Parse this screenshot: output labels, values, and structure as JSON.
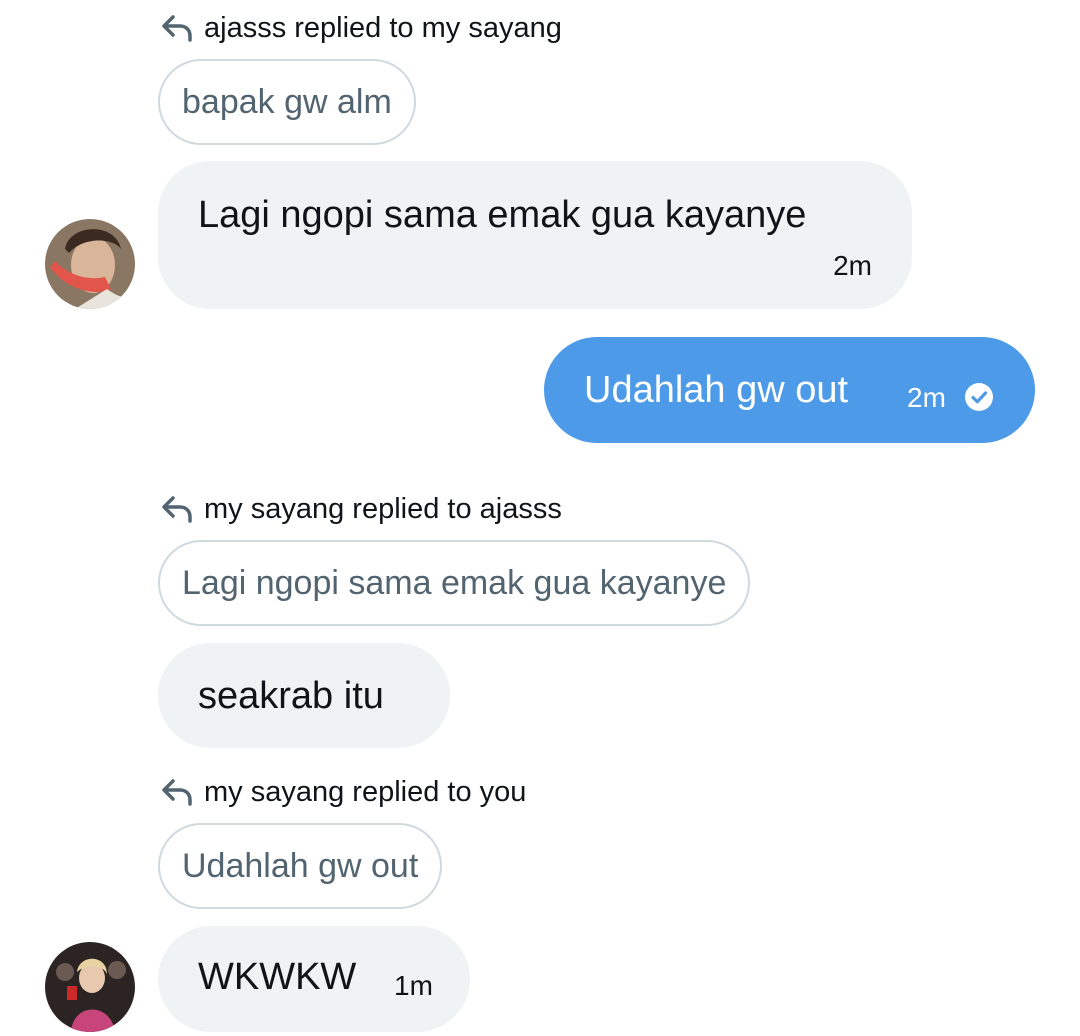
{
  "conversation": {
    "messages": [
      {
        "reply_header": "ajasss replied to my sayang",
        "quoted_text": "bapak gw alm",
        "text": "Lagi ngopi sama emak gua kayanye",
        "time": "2m"
      },
      {
        "text": "Udahlah gw out",
        "time": "2m",
        "status_icon": "check-circle-icon"
      },
      {
        "reply_header": "my sayang replied to ajasss",
        "quoted_text": "Lagi ngopi sama emak gua kayanye",
        "text": "seakrab itu"
      },
      {
        "reply_header": "my sayang replied to you",
        "quoted_text": "Udahlah gw out",
        "text": "WKWKW",
        "time": "1m"
      }
    ]
  },
  "colors": {
    "outgoing_bubble": "#4c9ae8",
    "incoming_bubble": "#eff3f4",
    "quote_border": "#cfd9de",
    "muted_text": "#536471"
  }
}
